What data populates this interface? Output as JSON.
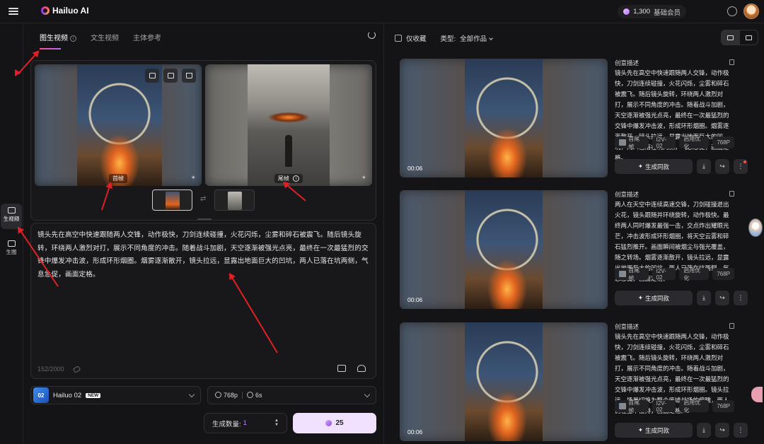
{
  "header": {
    "logo_text": "Hailuo AI",
    "credits": "1,300",
    "member_label": "基础会员"
  },
  "leftnav": {
    "items": [
      {
        "label": "生视频",
        "icon": "video-icon",
        "active": true
      },
      {
        "label": "生图",
        "icon": "image-icon",
        "active": false
      }
    ]
  },
  "tabs": [
    {
      "label": "图生视频",
      "active": true
    },
    {
      "label": "文生视频",
      "active": false
    },
    {
      "label": "主体参考",
      "active": false
    }
  ],
  "frames": {
    "first_label": "首帧",
    "last_label": "尾帧"
  },
  "prompt": {
    "text": "镜头先在高空中快速跟随两人交锋，动作极快，刀剑连续碰撞，火花闪烁，尘雾和碎石被震飞。随后镜头旋转，环绕两人激烈对打，展示不同角度的冲击。随着战斗加剧，天空逐渐被强光点亮，最终在一次最猛烈的交锋中爆发冲击波，形成环形烟圈。烟雾逐渐散开，镜头拉远，显露出地面巨大的凹坑，两人已落在坑两侧，气息急促，画面定格。",
    "char_count": "152/2000"
  },
  "controls": {
    "model_name": "Hailuo 02",
    "model_logo_text": "02",
    "new_badge": "NEW",
    "resolution": "768p",
    "duration": "6s",
    "count_label": "生成数量:",
    "count_value": "1",
    "generate_cost": "25"
  },
  "filter": {
    "favorites_label": "仅收藏",
    "type_label": "类型:",
    "type_value": "全部作品"
  },
  "cards": [
    {
      "duration": "00:06",
      "desc_title": "创意描述",
      "description": "镜头先在高空中快速跟随两人交锋，动作极快，刀剑连续碰撞，火花闪烁，尘雾和碎石被震飞。随后镜头旋转，环绕两人激烈对打，展示不同角度的冲击。随着战斗加剧，天空逐渐被强光点亮，最终在一次最猛烈的交锋中爆发冲击波，形成环形烟圈。烟雾逐渐散开，镜头拉远，显露出地面巨大的凹坑，两人已落在坑两侧，气息急促，画面定格。",
      "tags": [
        "首尾帧",
        "I2V-02",
        "启用优化",
        "768P"
      ],
      "action_label": "生成同款"
    },
    {
      "duration": "00:06",
      "desc_title": "创意描述",
      "description": "两人在天空中连续高速交锋，刀剑碰撞迸出火花，镜头跟随并环绕旋转，动作极快。最终两人同时爆发最强一击，交点炸出耀眼光芒，冲击波形成环形烟圈，将天空云雾和碎石猛烈推开。画面瞬间被烟尘与强光覆盖，随之转场。烟雾逐渐散开，镜头拉远，显露出地面巨大的凹坑，两人已落在坑两侧，气息急促，画面定格。",
      "tags": [
        "首尾帧",
        "I2V-02",
        "启用优化",
        "768P"
      ],
      "action_label": "生成同款"
    },
    {
      "duration": "00:06",
      "desc_title": "创意描述",
      "description": "镜头先在高空中快速跟随两人交锋，动作极快，刀剑连续碰撞，火花闪烁，尘雾和碎石被震飞。随后镜头旋转，环绕两人激烈对打，展示不同角度的冲击。随着战斗加剧，天空逐渐被强光点亮，最终在一次最猛烈的交锋中爆发冲击波，形成环形烟圈。镜头拉远，场景切换为整个废墟战场的俯瞰，两人仍在空中僵持，画面定格。",
      "tags": [
        "首尾帧",
        "I2V-02",
        "启用优化",
        "768P"
      ],
      "action_label": "生成同款"
    }
  ]
}
